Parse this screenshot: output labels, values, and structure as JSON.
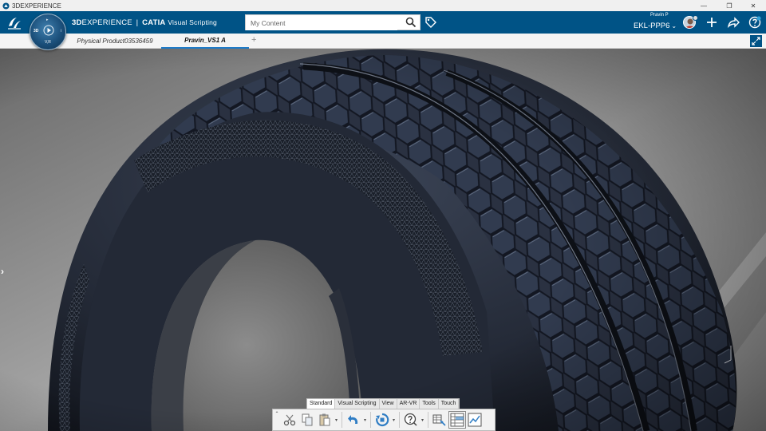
{
  "window": {
    "title": "3DEXPERIENCE",
    "icon": "3ds-app-icon",
    "controls": [
      "minimize-icon",
      "restore-icon",
      "close-icon"
    ],
    "control_glyphs": [
      "—",
      "❐",
      "✕"
    ]
  },
  "header": {
    "brand_prefix": "3D",
    "brand_experience": "EXPERIENCE",
    "brand_separator": "|",
    "brand_product": "CATIA",
    "brand_app": "Visual Scripting",
    "search_placeholder": "My Content",
    "user_name": "Pravin P",
    "tenant": "EKL-PPP6",
    "tenant_chevron": "⌄",
    "accent": "#005386"
  },
  "compass": {
    "north": "▸",
    "left": "3D",
    "right": "i",
    "bottom": "V,R"
  },
  "tabs": {
    "items": [
      {
        "label": "Physical Product03536459",
        "active": false
      },
      {
        "label": "Pravin_VS1 A",
        "active": true
      }
    ],
    "add_label": "+"
  },
  "viewport": {
    "side_arrow": "›",
    "content": "tire-model"
  },
  "action_bar": {
    "tabs": [
      {
        "label": "Standard",
        "active": true
      },
      {
        "label": "Visual Scripting",
        "active": false
      },
      {
        "label": "View",
        "active": false
      },
      {
        "label": "AR-VR",
        "active": false
      },
      {
        "label": "Tools",
        "active": false
      },
      {
        "label": "Touch",
        "active": false
      }
    ],
    "collapse_label": "⌃",
    "caret": "▾",
    "tools": [
      "cut-icon",
      "copy-icon",
      "paste-icon",
      "undo-icon",
      "update-icon",
      "help-icon",
      "design-table-icon",
      "knowledge-table-icon",
      "plot-icon"
    ]
  }
}
